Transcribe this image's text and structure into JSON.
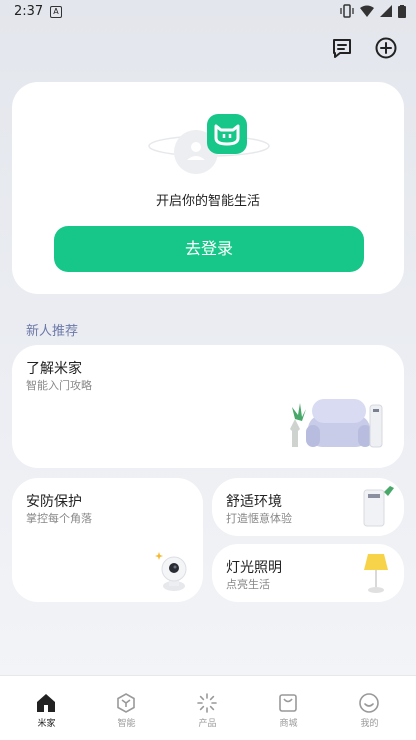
{
  "status_bar": {
    "time": "2:37",
    "notification_icon": "A"
  },
  "header": {
    "icons": [
      "message-icon",
      "add-circle-icon"
    ]
  },
  "hero": {
    "tagline": "开启你的智能生活",
    "login_label": "去登录"
  },
  "section": {
    "title": "新人推荐"
  },
  "cards": {
    "learn": {
      "title": "了解米家",
      "subtitle": "智能入门攻略"
    },
    "security": {
      "title": "安防保护",
      "subtitle": "掌控每个角落"
    },
    "comfort": {
      "title": "舒适环境",
      "subtitle": "打造惬意体验"
    },
    "lighting": {
      "title": "灯光照明",
      "subtitle": "点亮生活"
    }
  },
  "bottom_nav": {
    "items": [
      {
        "label": "米家",
        "icon": "home-icon",
        "active": true
      },
      {
        "label": "智能",
        "icon": "cube-icon",
        "active": false
      },
      {
        "label": "产品",
        "icon": "sparkle-icon",
        "active": false
      },
      {
        "label": "商城",
        "icon": "shop-bag-icon",
        "active": false
      },
      {
        "label": "我的",
        "icon": "smile-icon",
        "active": false
      }
    ]
  },
  "colors": {
    "accent": "#17c78a",
    "section_title": "#6b78a8"
  }
}
